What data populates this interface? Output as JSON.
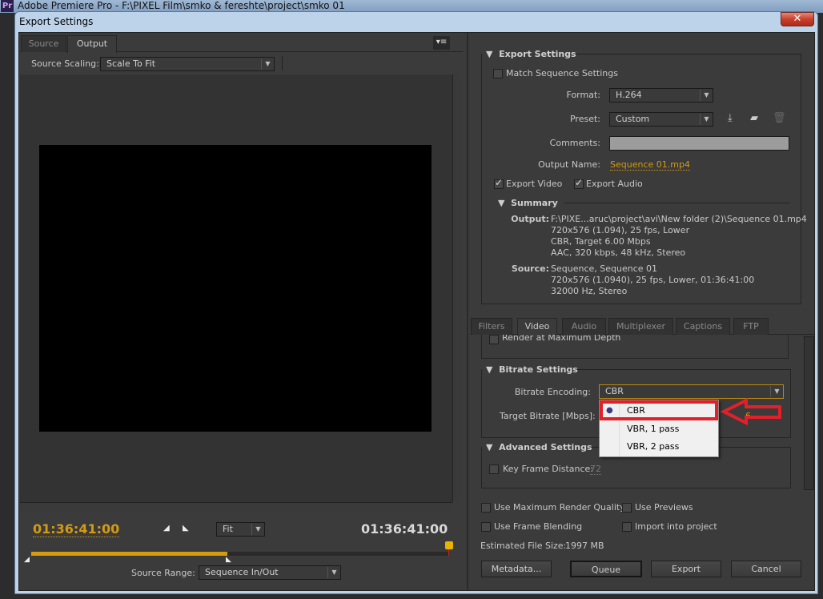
{
  "app": {
    "title": "Adobe Premiere Pro - F:\\PIXEL Film\\smko & fereshte\\project\\smko 01",
    "logo": "Pr"
  },
  "dialog": {
    "title": "Export Settings",
    "close_icon": "close-icon"
  },
  "left": {
    "tabs": [
      {
        "label": "Source",
        "active": false
      },
      {
        "label": "Output",
        "active": true
      }
    ],
    "menu_icon": "panel-menu-icon",
    "source_scaling_label": "Source Scaling:",
    "source_scaling_value": "Scale To Fit",
    "timecode_current": "01:36:41:00",
    "timecode_duration": "01:36:41:00",
    "zoom_value": "Fit",
    "range_progress_percent": 47,
    "source_range_label": "Source Range:",
    "source_range_value": "Sequence In/Out"
  },
  "export_settings": {
    "header": "Export Settings",
    "match_sequence": {
      "label": "Match Sequence Settings",
      "checked": false
    },
    "format_label": "Format:",
    "format_value": "H.264",
    "preset_label": "Preset:",
    "preset_value": "Custom",
    "comments_label": "Comments:",
    "comments_value": "",
    "output_name_label": "Output Name:",
    "output_name_value": "Sequence 01.mp4",
    "export_video": {
      "label": "Export Video",
      "checked": true
    },
    "export_audio": {
      "label": "Export Audio",
      "checked": true
    },
    "summary": {
      "header": "Summary",
      "output_label": "Output:",
      "output_lines": [
        "F:\\PIXE...aruc\\project\\avi\\New folder (2)\\Sequence 01.mp4",
        "720x576 (1.094), 25 fps, Lower",
        "CBR, Target 6.00 Mbps",
        "AAC, 320 kbps, 48 kHz, Stereo"
      ],
      "source_label": "Source:",
      "source_lines": [
        "Sequence, Sequence 01",
        "720x576 (1.0940), 25 fps, Lower, 01:36:41:00",
        "32000 Hz, Stereo"
      ]
    }
  },
  "settings_tabs": [
    {
      "label": "Filters",
      "active": false
    },
    {
      "label": "Video",
      "active": true
    },
    {
      "label": "Audio",
      "active": false
    },
    {
      "label": "Multiplexer",
      "active": false
    },
    {
      "label": "Captions",
      "active": false
    },
    {
      "label": "FTP",
      "active": false
    }
  ],
  "video": {
    "render_max_depth": "Render at Maximum Depth",
    "bitrate_header": "Bitrate Settings",
    "bitrate_encoding_label": "Bitrate Encoding:",
    "bitrate_encoding_value": "CBR",
    "target_bitrate_label": "Target Bitrate [Mbps]:",
    "target_bitrate_value": "6",
    "dropdown_options": [
      {
        "label": "CBR",
        "selected": true
      },
      {
        "label": "VBR, 1 pass",
        "selected": false
      },
      {
        "label": "VBR, 2 pass",
        "selected": false
      }
    ],
    "advanced_header": "Advanced Settings",
    "key_frame_label": "Key Frame Distance:",
    "key_frame_value": "72"
  },
  "bottom": {
    "max_render_quality": "Use Maximum Render Quality",
    "use_previews": "Use Previews",
    "frame_blending": "Use Frame Blending",
    "import_project": "Import into project",
    "file_size_label": "Estimated File Size:",
    "file_size_value": "1997 MB",
    "metadata_button": "Metadata...",
    "queue_button": "Queue",
    "export_button": "Export",
    "cancel_button": "Cancel"
  },
  "annotation_color": "#e3202a"
}
